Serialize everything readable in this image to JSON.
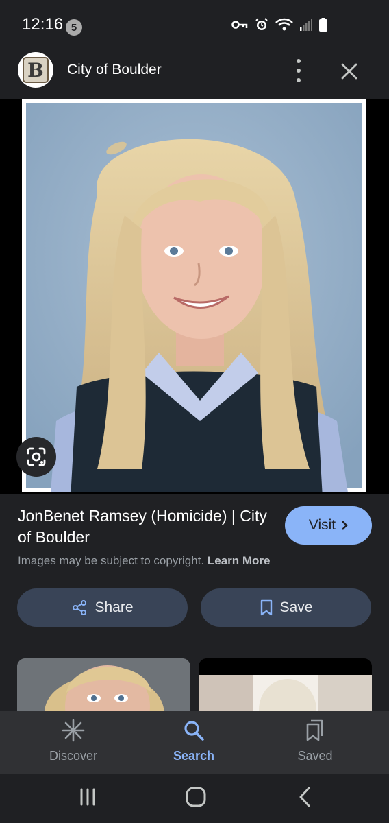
{
  "status_bar": {
    "time": "12:16",
    "notification_count": "5"
  },
  "header": {
    "site_name": "City of Boulder",
    "logo_letter": "B"
  },
  "result": {
    "title": "JonBenet Ramsey (Homicide) | City of Boulder",
    "visit_label": "Visit",
    "copyright_text": "Images may be subject to copyright.",
    "learn_more_label": "Learn More"
  },
  "actions": {
    "share_label": "Share",
    "save_label": "Save"
  },
  "bottom_nav": {
    "items": [
      {
        "label": "Discover",
        "icon": "asterisk-icon",
        "active": false
      },
      {
        "label": "Search",
        "icon": "search-icon",
        "active": true
      },
      {
        "label": "Saved",
        "icon": "bookmark-stack-icon",
        "active": false
      }
    ]
  },
  "colors": {
    "accent": "#8ab4f8",
    "background": "#202124",
    "button_bg": "#394457"
  }
}
